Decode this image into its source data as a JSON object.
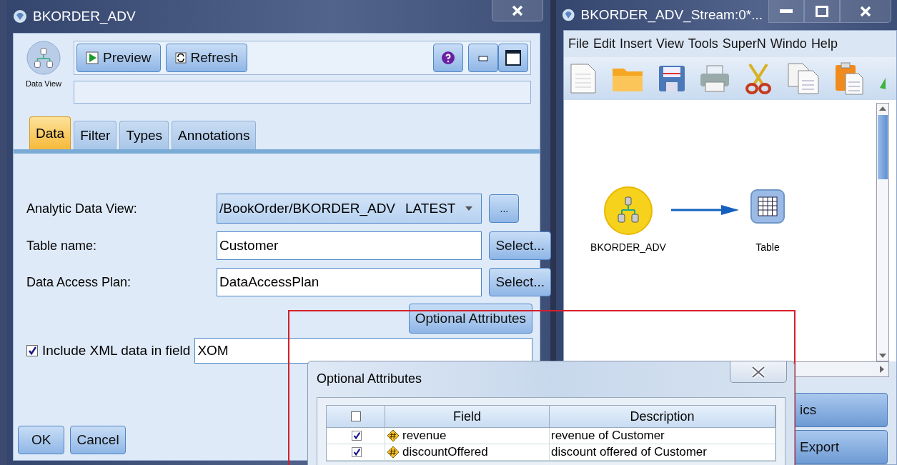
{
  "node_window": {
    "title": "BKORDER_ADV",
    "node_label": "Data View",
    "toolbar": [
      {
        "label": "Preview",
        "kind": "preview"
      },
      {
        "label": "Refresh",
        "kind": "refresh"
      }
    ],
    "tabs": [
      {
        "label": "Data",
        "selected": true
      },
      {
        "label": "Filter",
        "selected": false
      },
      {
        "label": "Types",
        "selected": false
      },
      {
        "label": "Annotations",
        "selected": false
      }
    ],
    "form": [
      {
        "label": "Analytic Data View:",
        "kind": "dropdown",
        "value": "/BookOrder/BKORDER_ADV",
        "version": "LATEST",
        "button": "..."
      },
      {
        "label": "Table name:",
        "kind": "text",
        "value": "Customer",
        "button": "Select..."
      },
      {
        "label": "Data Access Plan:",
        "kind": "text",
        "value": "DataAccessPlan",
        "button": "Select..."
      }
    ],
    "optional_button": "Optional Attributes",
    "include_xml": {
      "label": "Include XML data in field",
      "checked": true,
      "value": "XOM"
    },
    "buttons": [
      "OK",
      "Cancel"
    ]
  },
  "stream_window": {
    "title": "BKORDER_ADV_Stream:0*...",
    "menu": [
      "File",
      "Edit",
      "Insert",
      "View",
      "Tools",
      "SuperN",
      "Windo",
      "Help"
    ],
    "nodes": [
      {
        "label": "BKORDER_ADV",
        "kind": "source"
      },
      {
        "label": "Table",
        "kind": "table"
      }
    ],
    "side_buttons": [
      "ics",
      "Export"
    ]
  },
  "dialog": {
    "title": "Optional Attributes",
    "select_all": false,
    "columns": [
      "Field",
      "Description"
    ],
    "rows": [
      {
        "checked": true,
        "field": "revenue",
        "description": "revenue of Customer"
      },
      {
        "checked": true,
        "field": "discountOffered",
        "description": "discount offered of Customer"
      }
    ]
  }
}
